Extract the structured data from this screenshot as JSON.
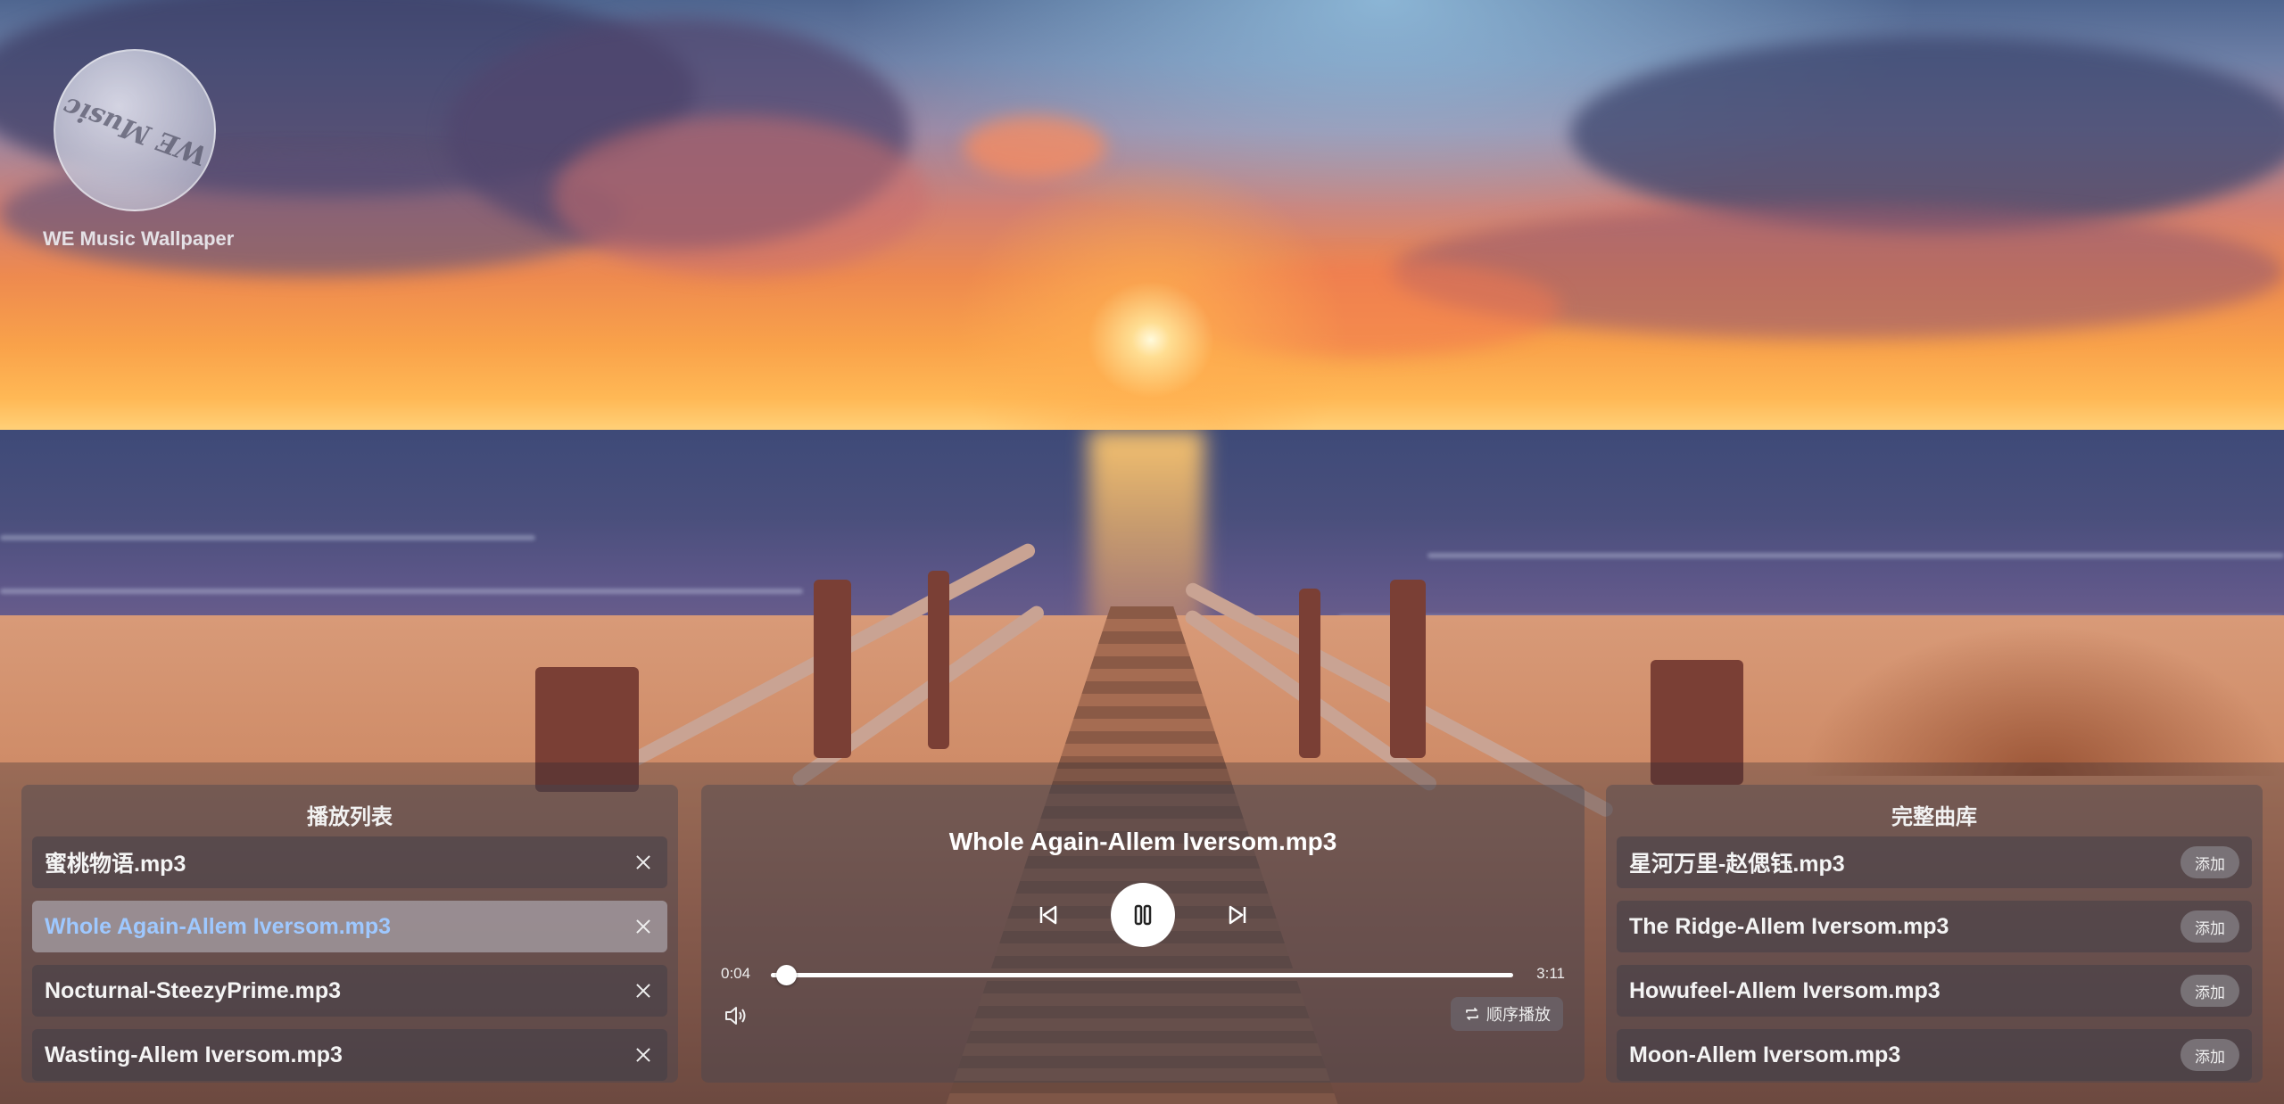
{
  "app": {
    "logo_text": "WE Music",
    "caption": "WE Music Wallpaper"
  },
  "playlist": {
    "title": "播放列表",
    "items": [
      {
        "label": "蜜桃物语.mp3",
        "active": false
      },
      {
        "label": "Whole Again-Allem Iversom.mp3",
        "active": true
      },
      {
        "label": "Nocturnal-SteezyPrime.mp3",
        "active": false
      },
      {
        "label": "Wasting-Allem Iversom.mp3",
        "active": false
      }
    ]
  },
  "player": {
    "now_playing": "Whole Again-Allem Iversom.mp3",
    "current_time": "0:04",
    "total_time": "3:11",
    "progress_fraction": 0.021,
    "mode_label": "顺序播放",
    "state": "playing"
  },
  "library": {
    "title": "完整曲库",
    "add_label": "添加",
    "items": [
      {
        "label": "星河万里-赵偲钰.mp3"
      },
      {
        "label": "The Ridge-Allem Iversom.mp3"
      },
      {
        "label": "Howufeel-Allem Iversom.mp3"
      },
      {
        "label": "Moon-Allem Iversom.mp3"
      }
    ]
  },
  "colors": {
    "active_track": "#9ec8ff",
    "panel_bg": "rgba(70,70,80,0.42)"
  },
  "icons": {
    "previous": "skip-previous-icon",
    "pause": "pause-icon",
    "next": "skip-next-icon",
    "volume": "volume-icon",
    "repeat": "repeat-icon",
    "close": "close-icon"
  }
}
